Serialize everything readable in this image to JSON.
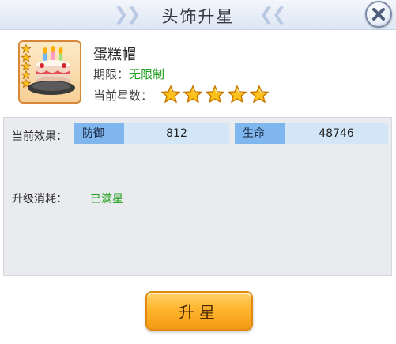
{
  "window": {
    "title": "头饰升星"
  },
  "item": {
    "name": "蛋糕帽",
    "icon": "birthday-cake-hat-icon",
    "term_label": "期限：",
    "term_value": "无限制",
    "stars_label": "当前星数：",
    "current_stars": 5,
    "max_stars": 5
  },
  "effects": {
    "label": "当前效果：",
    "defense_name": "防御",
    "defense_value": "812",
    "life_name": "生命",
    "life_value": "48746"
  },
  "cost": {
    "label": "升级消耗：",
    "value": "已满星"
  },
  "actions": {
    "upgrade_label": "升星"
  },
  "colors": {
    "accent_green": "#21a01f",
    "stat_header_blue": "#7fb6ee",
    "button_orange": "#ffb52e",
    "star_gold": "#ffc21c"
  }
}
